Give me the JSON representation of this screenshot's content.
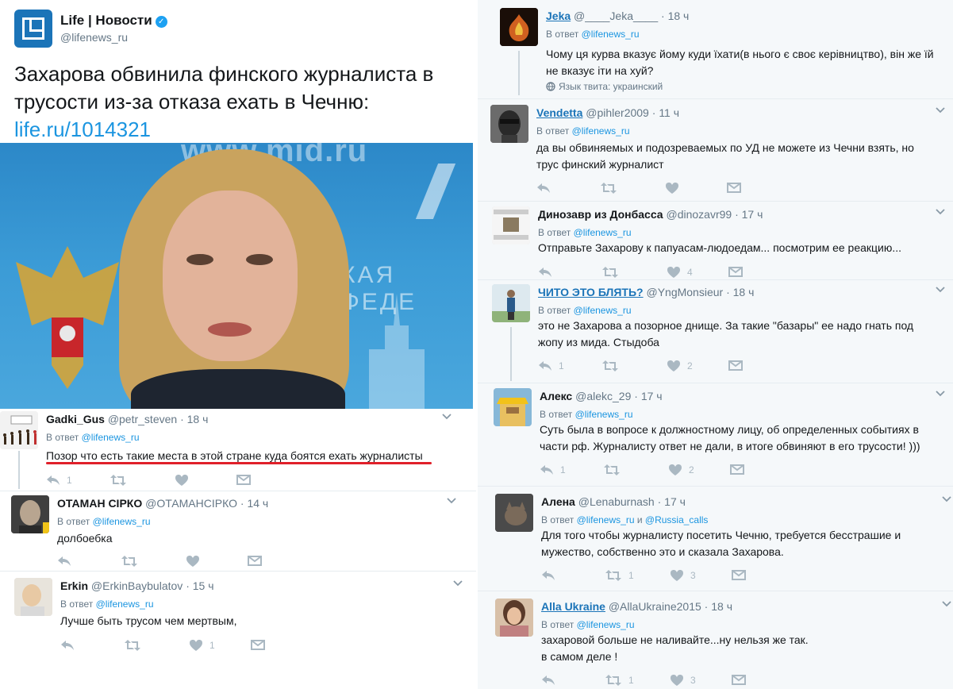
{
  "main": {
    "name": "Life | Новости",
    "handle": "@lifenews_ru",
    "text": "Захарова обвинила финского журналиста в трусости из-за отказа ехать в Чечню:",
    "link": "life.ru/1014321",
    "photo_watermark": "www.mid.ru",
    "photo_text": "КАЯ ФЕДЕ"
  },
  "reply_prefix": "В ответ",
  "tweets": [
    {
      "name": "Gadki_Gus",
      "handle": "@petr_steven",
      "time": "18 ч",
      "reply_to": "@lifenews_ru",
      "text": [
        "Позор что есть такие места в этой стране куда боятся ехать журналисты"
      ],
      "replies": "1",
      "retweets": "",
      "likes": ""
    },
    {
      "name": "ОТАМАН СІРКО",
      "handle": "@ОТАМАНСІРКО",
      "time": "14 ч",
      "reply_to": "@lifenews_ru",
      "text": [
        "долбоебка"
      ],
      "replies": "",
      "retweets": "",
      "likes": ""
    },
    {
      "name": "Erkin",
      "handle": "@ErkinBaybulatov",
      "time": "15 ч",
      "reply_to": "@lifenews_ru",
      "text": [
        "Лучше быть трусом чем мертвым,"
      ],
      "replies": "",
      "retweets": "",
      "likes": "1"
    },
    {
      "name": "Jeka",
      "handle": "@____Jeka____",
      "time": "18 ч",
      "reply_to": "@lifenews_ru",
      "text": [
        "Чому ця курва вказує йому куди їхати(в нього є своє керівництво), він же їй",
        "не вказує іти на хуй?"
      ],
      "lang": "Язык твита: украинский"
    },
    {
      "name": "Vendetta",
      "handle": "@pihler2009",
      "time": "11 ч",
      "reply_to": "@lifenews_ru",
      "text": [
        "да вы обвиняемых и подозреваемых по УД не можете из Чечни взять, но",
        "трус финский журналист"
      ],
      "replies": "",
      "retweets": "",
      "likes": ""
    },
    {
      "name": "Динозавр из Донбасса",
      "handle": "@dinozavr99",
      "time": "17 ч",
      "reply_to": "@lifenews_ru",
      "text": [
        "Отправьте Захарову к папуасам-людоедам... посмотрим ее реакцию..."
      ],
      "replies": "",
      "retweets": "",
      "likes": "4"
    },
    {
      "name": "ЧИТО ЭТО БЛЯТЬ?",
      "handle": "@YngMonsieur",
      "time": "18 ч",
      "reply_to": "@lifenews_ru",
      "text": [
        "это не Захарова а позорное днище. За такие \"базары\" ее надо гнать под",
        "жопу из мида. Стыдоба"
      ],
      "replies": "1",
      "retweets": "",
      "likes": "2"
    },
    {
      "name": "Алекс",
      "handle": "@alekc_29",
      "time": "17 ч",
      "reply_to": "@lifenews_ru",
      "text": [
        "Суть была в вопросе к должностному лицу, об определенных событиях в",
        "части рф. Журналисту ответ не дали, в итоге обвиняют в его трусости! )))"
      ],
      "replies": "1",
      "retweets": "",
      "likes": "2"
    },
    {
      "name": "Алена",
      "handle": "@Lenaburnash",
      "time": "17 ч",
      "reply_to": "@lifenews_ru",
      "reply_to_2": "@Russia_calls",
      "reply_and": "и",
      "text": [
        "Для того чтобы журналисту посетить Чечню, требуется бесстрашие и",
        "мужество, собственно это и сказала Захарова."
      ],
      "replies": "",
      "retweets": "1",
      "likes": "3"
    },
    {
      "name": "Alla Ukraine",
      "handle": "@AllaUkraine2015",
      "time": "18 ч",
      "reply_to": "@lifenews_ru",
      "text": [
        "захаровой больше не наливайте...ну нельзя же так.",
        "в самом деле !"
      ],
      "replies": "",
      "retweets": "1",
      "likes": "3"
    }
  ],
  "colors": {
    "accent": "#1b95e0",
    "muted": "#657786",
    "icon": "#aab8c2",
    "underline": "#e0202a"
  },
  "icons": [
    "reply-icon",
    "retweet-icon",
    "like-icon",
    "message-icon",
    "chevron-down-icon",
    "globe-icon",
    "verified-icon"
  ]
}
